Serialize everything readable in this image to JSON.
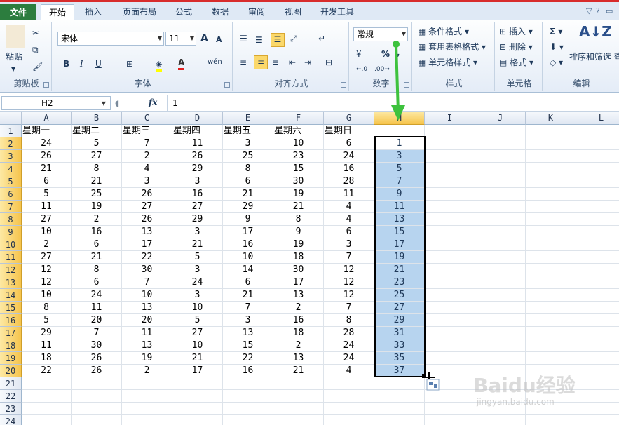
{
  "tabs": [
    "文件",
    "开始",
    "插入",
    "页面布局",
    "公式",
    "数据",
    "审阅",
    "视图",
    "开发工具"
  ],
  "active_tab": "开始",
  "ribbon": {
    "clipboard": {
      "label": "剪贴板",
      "paste": "粘贴"
    },
    "font": {
      "label": "字体",
      "name": "宋体",
      "size": "11",
      "bold": "B",
      "italic": "I",
      "underline": "U",
      "grow": "A",
      "shrink": "A",
      "phonetic": "wén"
    },
    "align": {
      "label": "对齐方式"
    },
    "number": {
      "label": "数字",
      "format": "常规",
      "percent": "%",
      "comma": ","
    },
    "styles": {
      "label": "样式",
      "cond": "条件格式",
      "table": "套用表格格式",
      "cell": "单元格样式"
    },
    "cells": {
      "label": "单元格",
      "insert": "插入",
      "delete": "删除",
      "format": "格式"
    },
    "editing": {
      "label": "编辑",
      "sort": "排序和筛选",
      "sigma": "Σ",
      "sort_tail": "查"
    }
  },
  "formula_bar": {
    "name_box": "H2",
    "fx": "fx",
    "value": "1"
  },
  "columns": [
    "A",
    "B",
    "C",
    "D",
    "E",
    "F",
    "G",
    "H",
    "I",
    "J",
    "K",
    "L"
  ],
  "header_row": [
    "星期一",
    "星期二",
    "星期三",
    "星期四",
    "星期五",
    "星期六",
    "星期日"
  ],
  "rows": [
    [
      24,
      5,
      7,
      11,
      3,
      10,
      6,
      1
    ],
    [
      26,
      27,
      2,
      26,
      25,
      23,
      24,
      3
    ],
    [
      21,
      8,
      4,
      29,
      8,
      15,
      16,
      5
    ],
    [
      6,
      21,
      3,
      3,
      6,
      30,
      28,
      7
    ],
    [
      5,
      25,
      26,
      16,
      21,
      19,
      11,
      9
    ],
    [
      11,
      19,
      27,
      27,
      29,
      21,
      4,
      11
    ],
    [
      27,
      2,
      26,
      29,
      9,
      8,
      4,
      13
    ],
    [
      10,
      16,
      13,
      3,
      17,
      9,
      6,
      15
    ],
    [
      2,
      6,
      17,
      21,
      16,
      19,
      3,
      17
    ],
    [
      27,
      21,
      22,
      5,
      10,
      18,
      7,
      19
    ],
    [
      12,
      8,
      30,
      3,
      14,
      30,
      12,
      21
    ],
    [
      12,
      6,
      7,
      24,
      6,
      17,
      12,
      23
    ],
    [
      10,
      24,
      10,
      3,
      21,
      13,
      12,
      25
    ],
    [
      8,
      11,
      13,
      10,
      7,
      2,
      7,
      27
    ],
    [
      5,
      20,
      20,
      5,
      3,
      16,
      8,
      29
    ],
    [
      29,
      7,
      11,
      27,
      13,
      18,
      28,
      31
    ],
    [
      11,
      30,
      13,
      10,
      15,
      2,
      24,
      33
    ],
    [
      18,
      26,
      19,
      21,
      22,
      13,
      24,
      35
    ],
    [
      22,
      26,
      2,
      17,
      16,
      21,
      4,
      37
    ]
  ],
  "row_numbers": [
    "1",
    "2",
    "3",
    "4",
    "5",
    "6",
    "7",
    "8",
    "9",
    "10",
    "11",
    "12",
    "13",
    "14",
    "15",
    "16",
    "17",
    "18",
    "19",
    "20",
    "21",
    "22",
    "23",
    "24"
  ],
  "selection": {
    "col": "H",
    "from_row": 2,
    "to_row": 20
  },
  "colors": {
    "accent": "#2c7d3e",
    "selection": "#b7d4ef",
    "header_sel": "#f6c44c",
    "arrow": "#3ec23e"
  },
  "watermark": {
    "main": "Baidu经验",
    "sub": "jingyan.baidu.com"
  }
}
